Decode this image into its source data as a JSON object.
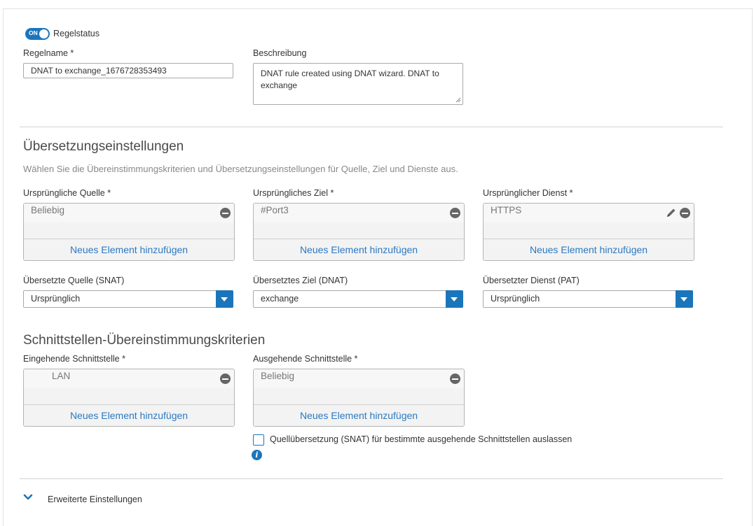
{
  "rule_status": {
    "toggle_text": "ON",
    "label": "Regelstatus"
  },
  "rule_name": {
    "label": "Regelname *",
    "value": "DNAT to exchange_1676728353493"
  },
  "description": {
    "label": "Beschreibung",
    "value": "DNAT rule created using DNAT wizard. DNAT to exchange"
  },
  "translation": {
    "title": "Übersetzungseinstellungen",
    "description": "Wählen Sie die Übereinstimmungskriterien und Übersetzungseinstellungen für Quelle, Ziel und Dienste aus.",
    "original_source": {
      "label": "Ursprüngliche Quelle *",
      "item": "Beliebig",
      "add": "Neues Element hinzufügen"
    },
    "original_destination": {
      "label": "Ursprüngliches Ziel *",
      "item": "#Port3",
      "add": "Neues Element hinzufügen"
    },
    "original_service": {
      "label": "Ursprünglicher Dienst *",
      "item": "HTTPS",
      "add": "Neues Element hinzufügen"
    },
    "translated_source": {
      "label": "Übersetzte Quelle (SNAT)",
      "value": "Ursprünglich"
    },
    "translated_destination": {
      "label": "Übersetztes Ziel (DNAT)",
      "value": "exchange"
    },
    "translated_service": {
      "label": "Übersetzter Dienst (PAT)",
      "value": "Ursprünglich"
    }
  },
  "interfaces": {
    "title": "Schnittstellen-Übereinstimmungskriterien",
    "inbound": {
      "label": "Eingehende Schnittstelle *",
      "item": "LAN",
      "add": "Neues Element hinzufügen"
    },
    "outbound": {
      "label": "Ausgehende Schnittstelle *",
      "item": "Beliebig",
      "add": "Neues Element hinzufügen"
    },
    "exclude_snat_label": "Quellübersetzung (SNAT) für bestimmte ausgehende Schnittstellen auslassen",
    "info_glyph": "i"
  },
  "advanced": {
    "label": "Erweiterte Einstellungen"
  },
  "colors": {
    "accent": "#1b75bb",
    "link": "#2b79c2"
  }
}
